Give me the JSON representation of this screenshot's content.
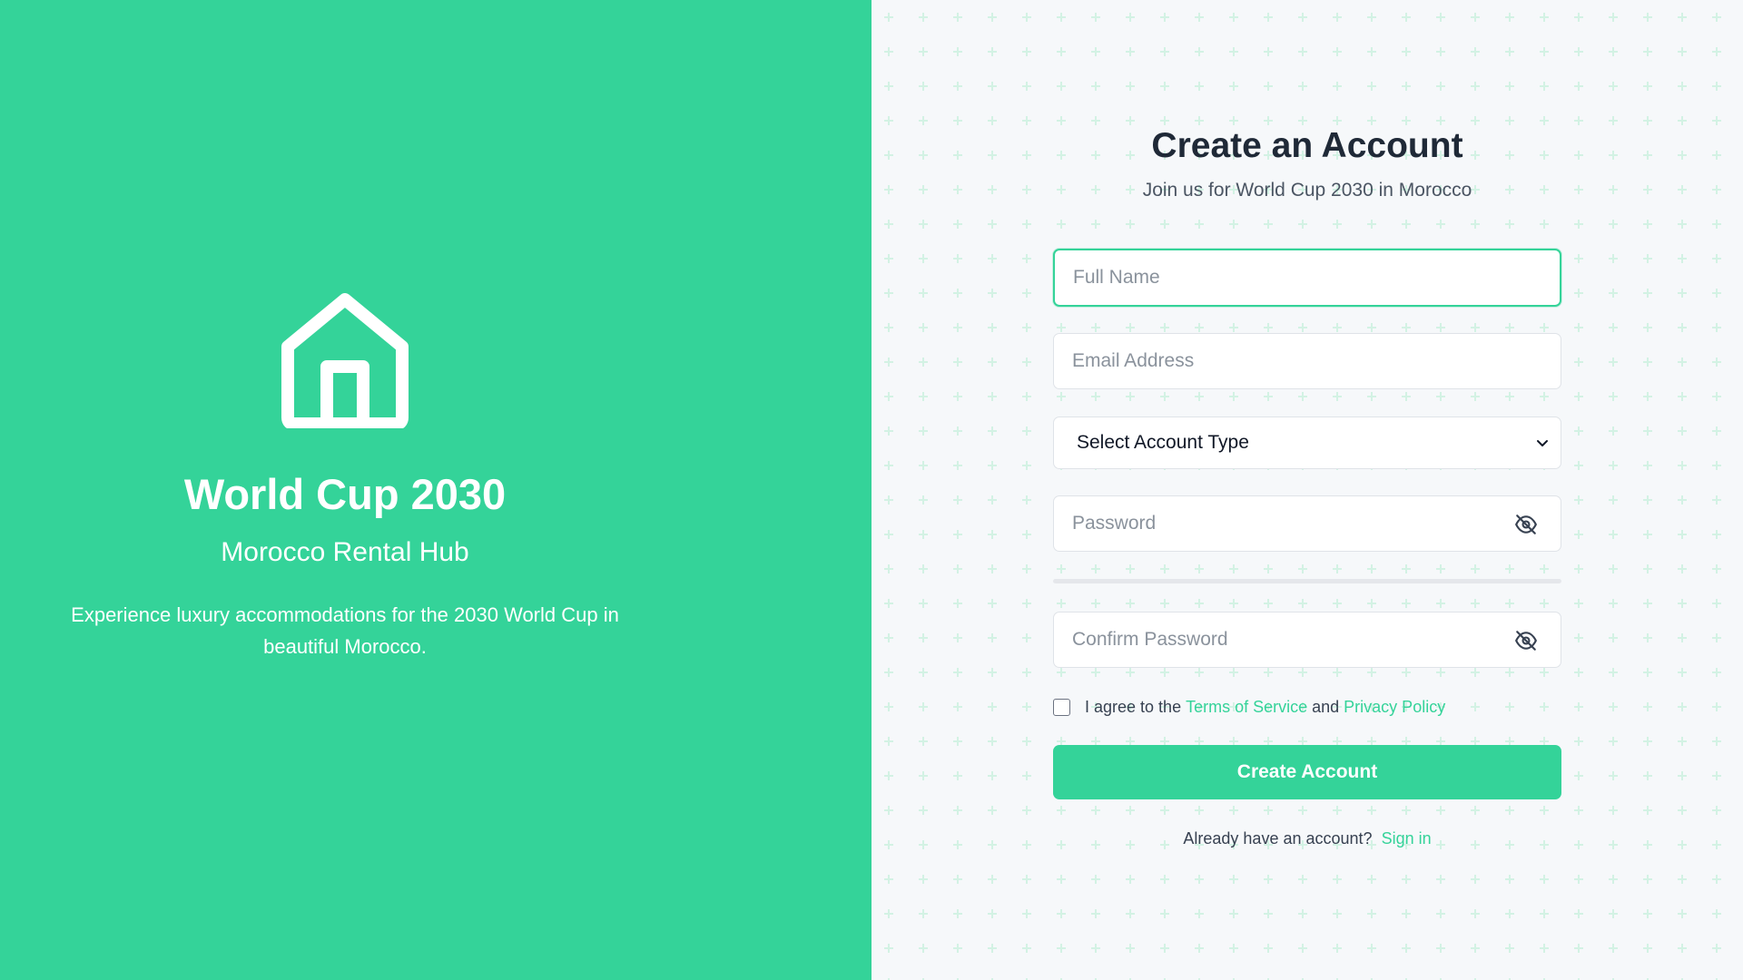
{
  "hero": {
    "title": "World Cup 2030",
    "subtitle": "Morocco Rental Hub",
    "description": "Experience luxury accommodations for the 2030 World Cup in beautiful Morocco.",
    "logo_icon": "home-icon"
  },
  "form": {
    "title": "Create an Account",
    "subtitle": "Join us for World Cup 2030 in Morocco",
    "full_name": {
      "placeholder": "Full Name",
      "value": ""
    },
    "email": {
      "placeholder": "Email Address",
      "value": ""
    },
    "account_type": {
      "selected": "Select Account Type"
    },
    "password": {
      "placeholder": "Password",
      "value": "",
      "toggle_icon": "eye-off-icon"
    },
    "confirm_password": {
      "placeholder": "Confirm Password",
      "value": "",
      "toggle_icon": "eye-off-icon"
    },
    "password_strength": 0,
    "terms": {
      "prefix": "I agree to the ",
      "tos_link": "Terms of Service",
      "and": " and ",
      "privacy_link": "Privacy Policy",
      "checked": false
    },
    "submit_label": "Create Account",
    "signin_prompt": "Already have an account?",
    "signin_link": "Sign in"
  },
  "colors": {
    "accent": "#34d399",
    "title": "#1f2937",
    "background": "#f6f8fa"
  }
}
